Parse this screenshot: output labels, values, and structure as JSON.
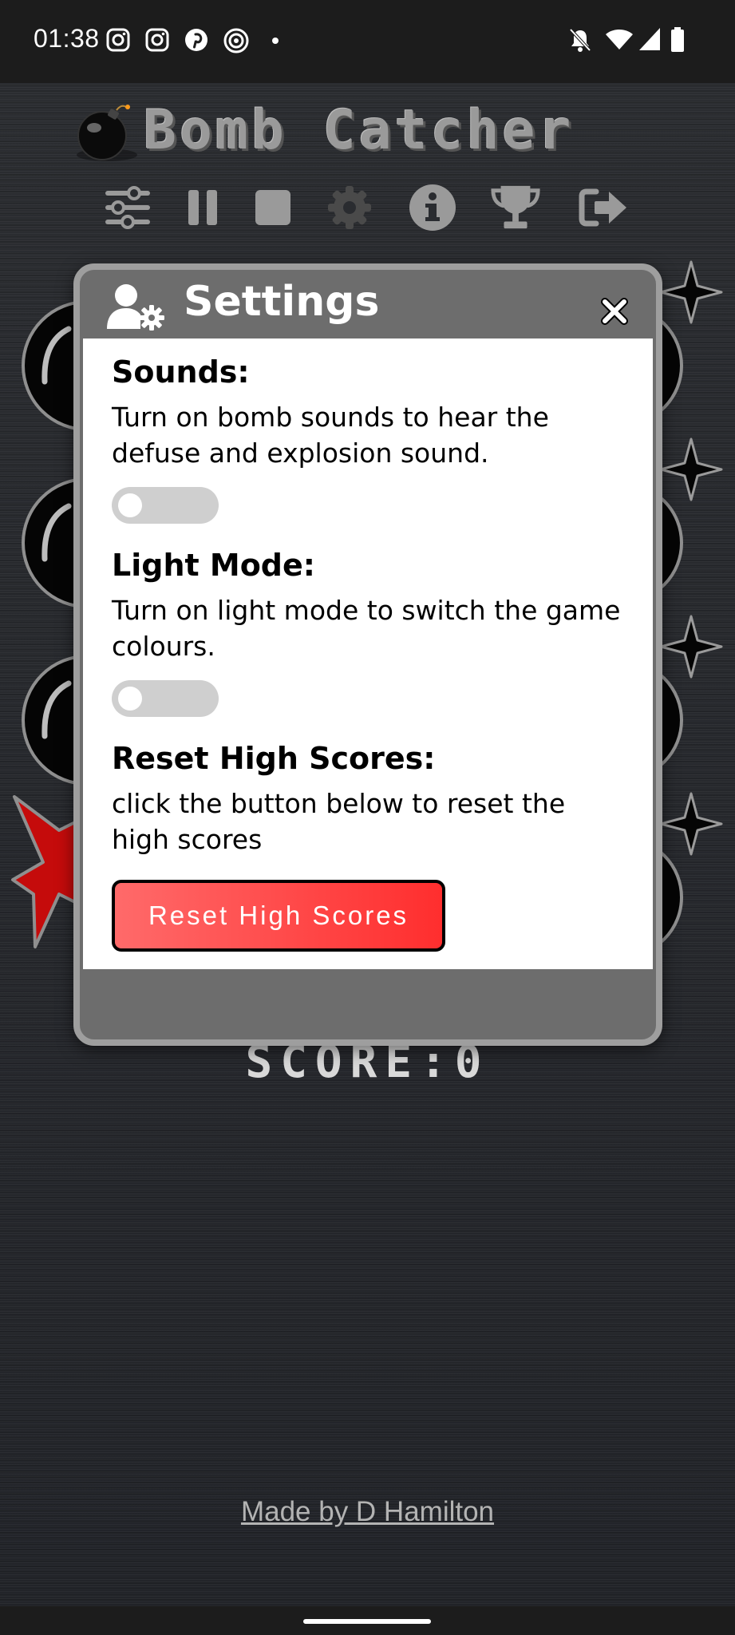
{
  "status_bar": {
    "time": "01:38",
    "left_icons": [
      "instagram-icon",
      "instagram-icon",
      "pinterest-icon",
      "threads-icon",
      "dot-icon"
    ],
    "right_icons": [
      "notifications-off-icon",
      "wifi-icon",
      "signal-icon",
      "battery-icon"
    ]
  },
  "header": {
    "title": "Bomb Catcher",
    "toolbar": [
      "sliders-icon",
      "pause-icon",
      "stop-icon",
      "gear-icon",
      "info-icon",
      "trophy-icon",
      "exit-icon"
    ]
  },
  "modal": {
    "title": "Settings",
    "sections": {
      "sounds": {
        "title": "Sounds:",
        "text": "Turn on bomb sounds to hear the defuse and explosion sound.",
        "enabled": false
      },
      "light_mode": {
        "title": "Light Mode:",
        "text": "Turn on light mode to switch the game colours.",
        "enabled": false
      },
      "reset": {
        "title": "Reset High Scores:",
        "text": "click the button below to reset the high scores",
        "button": "Reset High Scores"
      }
    }
  },
  "score_label": "SCORE:0",
  "credit": "Made by D Hamilton",
  "colors": {
    "modal_frame": "#6d6d6d",
    "modal_border": "#9e9e9e",
    "reset_button": "#ff3b3b",
    "toggle_off": "#cfcfcf"
  }
}
